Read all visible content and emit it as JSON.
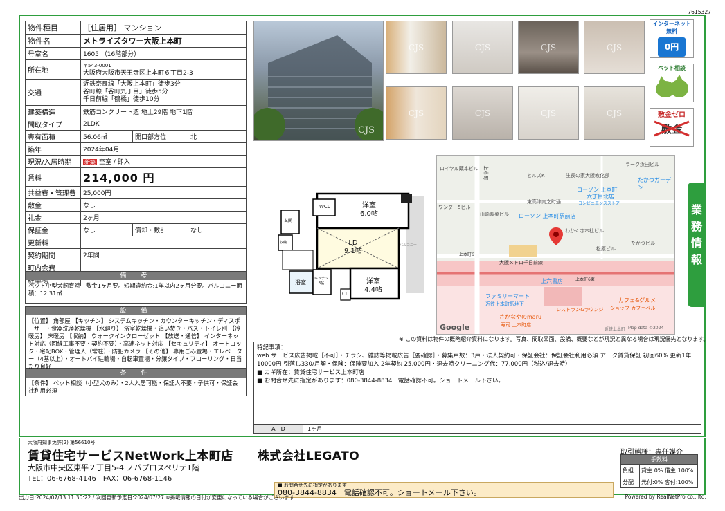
{
  "doc_id": "7615327",
  "info": [
    {
      "label": "物件種目",
      "value": "［住居用］ マンション"
    },
    {
      "label": "物件名",
      "value": "メトライズタワー大阪上本町"
    },
    {
      "label": "号室名",
      "value": "1605 （16階部分）"
    },
    {
      "label": "所在地",
      "value1": "〒543-0001",
      "value2": "大阪府大阪市天王寺区上本町６丁目2-3"
    },
    {
      "label": "交通",
      "lines": [
        "近鉄奈良線「大阪上本町」徒歩3分",
        "谷町線「谷町九丁目」徒歩5分",
        "千日前線「鶴橋」徒歩10分"
      ]
    },
    {
      "label": "建築構造",
      "value": "鉄筋コンクリート造 地上29階 地下1階"
    },
    {
      "label": "間取タイプ",
      "value": "2LDK"
    },
    {
      "label": "専有面積",
      "value": "56.06㎡",
      "label2": "開口部方位",
      "value2": "北"
    },
    {
      "label": "築年",
      "value": "2024年04月"
    },
    {
      "label": "現況/入居時期",
      "tag": "新築",
      "value": "空室 / 即入"
    },
    {
      "label": "賃料",
      "value": "214,000 円"
    },
    {
      "label": "共益費・管理費",
      "value": "25,000円"
    },
    {
      "label": "敷金",
      "value": "なし"
    },
    {
      "label": "礼金",
      "value": "2ヶ月"
    },
    {
      "label": "保証金",
      "value": "なし",
      "label2": "償却・敷引",
      "value2": "なし"
    },
    {
      "label": "更新料",
      "value": ""
    },
    {
      "label": "契約期間",
      "value": "2年間"
    },
    {
      "label": "町内会費",
      "value": ""
    },
    {
      "label": "駐車場",
      "value": ""
    }
  ],
  "biko": {
    "title": "備　考",
    "text": "ペット小型犬飼育時　敷金1ヶ月要。短期違約金:1年以内2ヶ月分要。バルコニー面積：12.31㎡"
  },
  "setsubi": {
    "title": "設　備",
    "text": "【位置】 角部屋 【キッチン】 システムキッチン・カウンターキッチン・ディスポーザー・食器洗浄乾燥機 【水廻り】 浴室乾燥機・追い焚き・バス・トイレ別 【冷暖房】 床暖房 【収納】 ウォークインクローゼット 【放送・通信】 インターネット対応（回線工事不要・契約不要）・高速ネット対応 【セキュリティ】 オートロック・宅配BOX・管理人（常駐）・防犯カメラ 【その他】 専用ごみ置場・エレベーター（4基以上）・オートバイ駐輪場・自転車置場・分譲タイプ・フローリング・日当たり良好"
  },
  "joken": {
    "title": "条　件",
    "text": "【条件】 ペット相談（小型犬のみ）・2人入居可能・保証人不要・子供可・保証会社利用必須"
  },
  "photos": {
    "watermark": "CJS"
  },
  "badges": {
    "internet": "インターネット無料",
    "internet_price": "0円",
    "pet": "ペット相談",
    "shikikin": "敷金ゼロ",
    "shikikin_mark": "敷金"
  },
  "plan": {
    "rooms": [
      {
        "name": "洋室",
        "size": "6.0帖"
      },
      {
        "name": "LD",
        "size": "9.1帖"
      },
      {
        "name": "洋室",
        "size": "4.4帖"
      },
      {
        "name": "WCL"
      },
      {
        "name": "玄関"
      },
      {
        "name": "浴室"
      },
      {
        "name": "キッチン",
        "size": "3帖"
      },
      {
        "name": "CL"
      },
      {
        "name": "収納"
      },
      {
        "name": "バルコニー"
      }
    ]
  },
  "map": {
    "labels": [
      "ロイヤル蔵本ビル",
      "上本町",
      "ヒルズK",
      "生長の家大阪教化部",
      "ラーク浜田ビル",
      "たかつガーデン",
      "ローソン 上本町",
      "六丁目北店",
      "コンビニエンスストア",
      "ワンダー5ビル",
      "東高津南之町通",
      "山崎製菓ビル",
      "ローソン 上本町駅前店",
      "わかくさ本社ビル",
      "松原ビル",
      "たかつビル",
      "大阪メトロ千日前線",
      "上本町6",
      "上本町6東",
      "上六書房",
      "ファミリーマート",
      "近鉄上本町駅地下",
      "カフェ&グルメ",
      "ショップ カフェベル",
      "レストラン&ラウンジ",
      "さかなやのmaru",
      "寿司 上本町店",
      "近鉄上本町",
      "Map data ©2024"
    ],
    "google": "Google",
    "gyomu": "業務情報"
  },
  "disclaimer": "※ この資料は物件の概略紹介資料になります。写真、間取図面、設備、概要などが現況と異なる場合は現況優先となります。",
  "notes": {
    "title": "特記事項：",
    "lines": [
      "web サービス広告掲載［不可］・チラシ、雑誌等掲載広告［要確認］・募集戸数：3戸・法人契約可・保証会社：保証会社利用必須 アーク賃貸保証 初回60% 更新1年10000円 引落し330/月額・保険：保険要加入 2年契約 25,000円・退去時クリーニング代：77,000円（税込/退去時）",
      "■ カギ所在：賃貸住宅サービス上本町店",
      "■ お問合せ先に指定があります：080-3844-8834　電話確認不可。ショートメール下さい。"
    ]
  },
  "ad": {
    "label": "A　D",
    "value": "1ヶ月"
  },
  "company": {
    "license": "大阪府知事免許(2) 第56610号",
    "store": "賃貸住宅サービスNetWork上本町店　　株式会社LEGATO",
    "address": "大阪市中央区東平２丁目5-4 ノバプロスペリテ1階",
    "tel": "TEL：06-6768-4146　FAX：06-6768-1146"
  },
  "torihiki": "取引態様：専任媒介",
  "fee": {
    "title": "手数料",
    "rows": [
      {
        "k": "負担",
        "v": "貸主:0% 借主:100%"
      },
      {
        "k": "分配",
        "v": "元付:0% 客付:100%"
      }
    ]
  },
  "inquiry": {
    "small": "■ お問合せ先に指定があります",
    "big": "080-3844-8834　電話確認不可。ショートメール下さい。"
  },
  "footer": {
    "left": "出力日:2024/07/13 11:30:22 / 次回更新予定日:2024/07/27 ※掲載情報の日付が変更になっている場合がございます",
    "right": "Powered by RealNetPro co., ltd."
  }
}
